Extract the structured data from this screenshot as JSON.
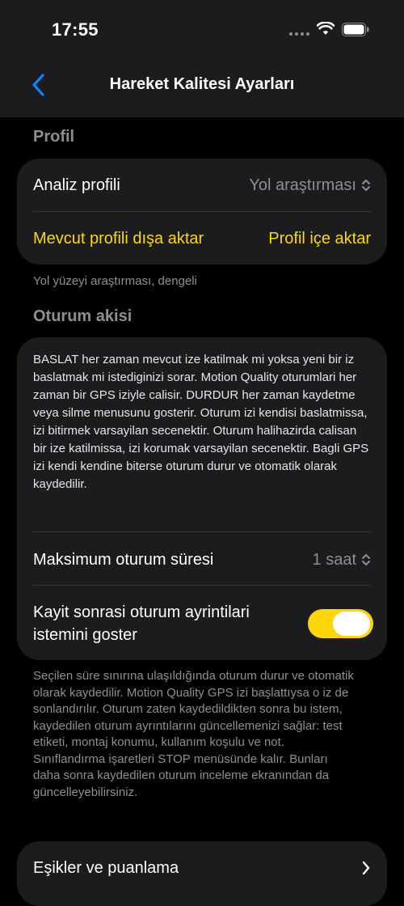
{
  "status": {
    "time": "17:55"
  },
  "nav": {
    "title": "Hareket Kalitesi Ayarları"
  },
  "profile_section": {
    "title": "Profil",
    "analysis_label": "Analiz profili",
    "analysis_value": "Yol araştırması",
    "export_label": "Mevcut profili dışa aktar",
    "import_label": "Profil içe aktar",
    "footnote": "Yol yüzeyi araştırması, dengeli"
  },
  "session_section": {
    "title": "Oturum akisi",
    "description": "BASLAT her zaman mevcut ize katilmak mi yoksa yeni bir iz baslatmak mi istediginizi sorar. Motion Quality oturumlari her zaman bir GPS iziyle calisir. DURDUR her zaman kaydetme veya silme menusunu gosterir. Oturum izi kendisi baslatmissa, izi bitirmek varsayilan secenektir. Oturum halihazirda calisan bir ize katilmissa, izi korumak varsayilan secenektir. Bagli GPS izi kendi kendine biterse oturum durur ve otomatik olarak kaydedilir.",
    "max_duration_label": "Maksimum oturum süresi",
    "max_duration_value": "1 saat",
    "prompt_label": "Kayit sonrasi oturum ayrintilari istemini goster",
    "prompt_enabled": true,
    "footnote": "Seçilen süre sınırına ulaşıldığında oturum durur ve otomatik olarak kaydedilir. Motion Quality GPS izi başlattıysa o iz de sonlandırılır. Oturum zaten kaydedildikten sonra bu istem, kaydedilen oturum ayrıntılarını güncellemenizi sağlar: test etiketi, montaj konumu, kullanım koşulu ve not. Sınıflandırma işaretleri STOP menüsünde kalır. Bunları daha sonra kaydedilen oturum inceleme ekranından da güncelleyebilirsiniz."
  },
  "thresholds": {
    "label": "Eşikler ve puanlama"
  },
  "colors": {
    "accent": "#ffd60a",
    "back": "#0a84ff",
    "card": "#1c1c1e",
    "background": "#000000"
  }
}
